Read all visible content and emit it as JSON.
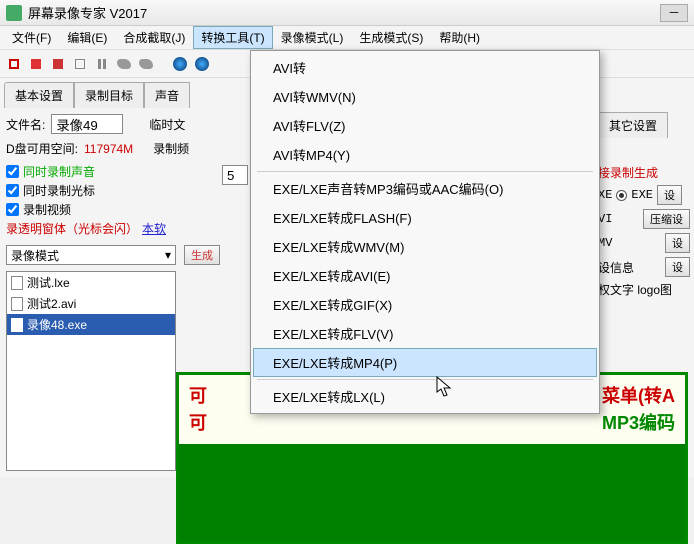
{
  "window": {
    "title": "屏幕录像专家 V2017"
  },
  "menu": {
    "items": [
      "文件(F)",
      "编辑(E)",
      "合成截取(J)",
      "转换工具(T)",
      "录像模式(L)",
      "生成模式(S)",
      "帮助(H)"
    ],
    "active_index": 3
  },
  "dropdown": {
    "groups": [
      [
        "AVI转",
        "AVI转WMV(N)",
        "AVI转FLV(Z)",
        "AVI转MP4(Y)"
      ],
      [
        "EXE/LXE声音转MP3编码或AAC编码(O)",
        "EXE/LXE转成FLASH(F)",
        "EXE/LXE转成WMV(M)",
        "EXE/LXE转成AVI(E)",
        "EXE/LXE转成GIF(X)",
        "EXE/LXE转成FLV(V)",
        "EXE/LXE转成MP4(P)"
      ],
      [
        "EXE/LXE转成LX(L)"
      ]
    ],
    "hover": "EXE/LXE转成MP4(P)"
  },
  "tabs": [
    "基本设置",
    "录制目标",
    "声音",
    "其它设置"
  ],
  "content": {
    "filename_label": "文件名:",
    "filename_value": "录像49",
    "tempdir_label": "临时文",
    "disk_label": "D盘可用空间:",
    "disk_value": "117974M",
    "rec_label": "录制频",
    "rec_value": "5",
    "cb_sound": "同时录制声音",
    "cb_cursor": "同时录制光标",
    "cb_video": "录制视频",
    "cb_transparent": "录透明窗体（光标会闪）",
    "link": "本软",
    "filelist_header": "录像模式",
    "gen_cut": "生成",
    "files": [
      "测试.lxe",
      "测试2.avi",
      "录像48.exe"
    ],
    "selected_file_index": 2
  },
  "right": {
    "tab_other": "其它设置",
    "direct": "接录制生成",
    "exe_off": "XE",
    "exe_on": "EXE",
    "set_btn": "设",
    "vi": "VI",
    "compress": "压缩设",
    "mv": "MV",
    "set2": "设",
    "info": "设信息",
    "set3": "设",
    "logo": "权文字 logo图"
  },
  "banner": {
    "line1_a": "可  ",
    "line1_b": "菜单(转A",
    "line2_a": "可  ",
    "line2_b": "MP3编码"
  }
}
